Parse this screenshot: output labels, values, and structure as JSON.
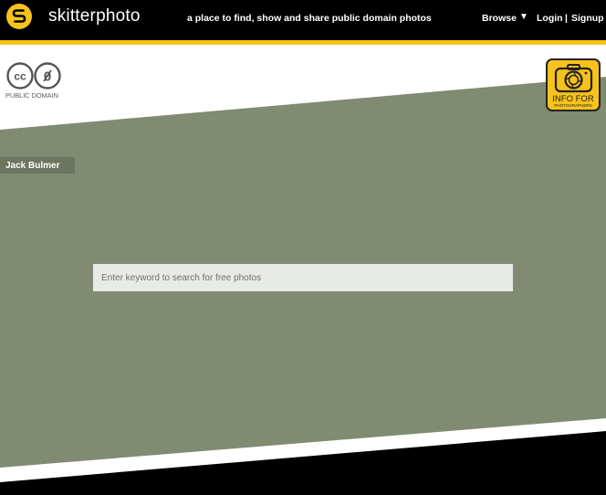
{
  "header": {
    "brand": "skitterphoto",
    "tagline": "a place to find, show and share public domain photos",
    "nav": {
      "browse_label": "Browse",
      "browse_caret": "▼",
      "login_label": "Login",
      "separator": "|",
      "signup_label": "Signup"
    }
  },
  "license": {
    "cc_text": "cc",
    "zero_text": "0",
    "label": "PUBLIC DOMAIN"
  },
  "info_badge": {
    "line1": "INFO FOR",
    "line2": "PHOTOGRAPHERS"
  },
  "photo": {
    "credit": "Jack Bulmer"
  },
  "search": {
    "placeholder": "Enter keyword to search for free photos",
    "value": ""
  },
  "colors": {
    "accent": "#f7c21b",
    "header_bg": "#000000",
    "hero_bg": "#808b71",
    "credit_bg": "#6c7560",
    "search_bg": "#e8eae6"
  }
}
